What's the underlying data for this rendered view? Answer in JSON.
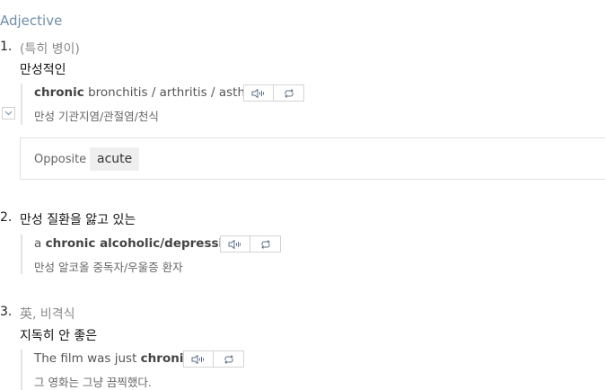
{
  "pos": "Adjective",
  "senses": [
    {
      "number": "1.",
      "note": "(특히 병이)",
      "meaning": "만성적인",
      "example": {
        "en_bold": "chronic",
        "en_rest": " bronchitis / arthritis / asthma",
        "ko": "만성 기관지염/관절염/천식"
      },
      "opposite": {
        "label": "Opposite",
        "word": "acute"
      }
    },
    {
      "number": "2.",
      "meaning": "만성 질환을 앓고 있는",
      "example": {
        "en_pre": "a ",
        "en_bold": "chronic alcoholic/depressive",
        "ko": "만성 알코올 중독자/우울증 환자"
      }
    },
    {
      "number": "3.",
      "note": "英, 비격식",
      "meaning": "지독히 안 좋은",
      "example": {
        "en_pre": "The film was just ",
        "en_bold": "chronic",
        "en_post": ".",
        "ko": "그 영화는 그냥 끔찍했다."
      }
    }
  ],
  "icons": [
    "speaker-icon",
    "repeat-icon",
    "chevron-down-icon"
  ]
}
